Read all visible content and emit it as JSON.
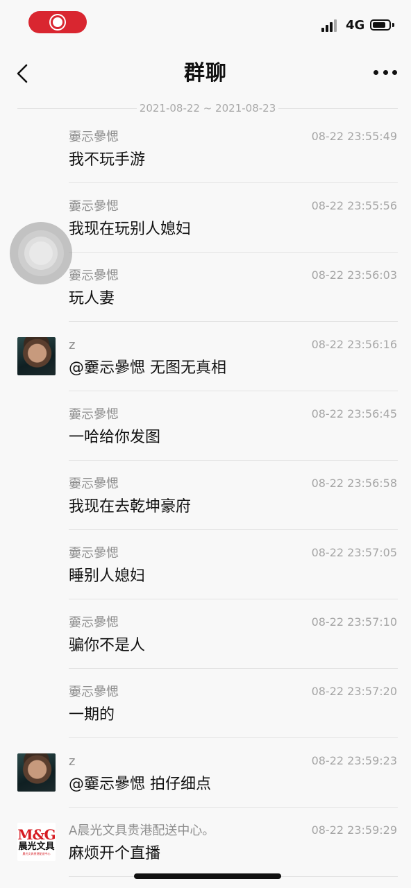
{
  "status_bar": {
    "network": "4G"
  },
  "nav": {
    "title": "群聊"
  },
  "date_range": "2021-08-22 ~ 2021-08-23",
  "messages": [
    {
      "sender": "嫑忈曑愢",
      "time": "08-22 23:55:49",
      "text": "我不玩手游",
      "avatar": "none"
    },
    {
      "sender": "嫑忈曑愢",
      "time": "08-22 23:55:56",
      "text": "我现在玩别人媳妇",
      "avatar": "none"
    },
    {
      "sender": "嫑忈曑愢",
      "time": "08-22 23:56:03",
      "text": "玩人妻",
      "avatar": "none"
    },
    {
      "sender": "z",
      "time": "08-22 23:56:16",
      "text": "@嫑忈曑愢 无图无真相",
      "avatar": "photo"
    },
    {
      "sender": "嫑忈曑愢",
      "time": "08-22 23:56:45",
      "text": "一哈给你发图",
      "avatar": "none"
    },
    {
      "sender": "嫑忈曑愢",
      "time": "08-22 23:56:58",
      "text": "我现在去乾坤豪府",
      "avatar": "none"
    },
    {
      "sender": "嫑忈曑愢",
      "time": "08-22 23:57:05",
      "text": "睡别人媳妇",
      "avatar": "none"
    },
    {
      "sender": "嫑忈曑愢",
      "time": "08-22 23:57:10",
      "text": "骗你不是人",
      "avatar": "none"
    },
    {
      "sender": "嫑忈曑愢",
      "time": "08-22 23:57:20",
      "text": "一期的",
      "avatar": "none"
    },
    {
      "sender": "z",
      "time": "08-22 23:59:23",
      "text": "@嫑忈曑愢 拍仔细点",
      "avatar": "photo"
    },
    {
      "sender": "A晨光文具贵港配送中心。",
      "time": "08-22 23:59:29",
      "text": "麻烦开个直播",
      "avatar": "logo"
    }
  ],
  "logo": {
    "brand": "M&G",
    "name": "晨光文具",
    "sub": "晨光文具贵港配送中心"
  },
  "colors": {
    "record_pill": "#d92630",
    "background": "#f8f8f8",
    "meta_text": "#a5a5a5"
  }
}
